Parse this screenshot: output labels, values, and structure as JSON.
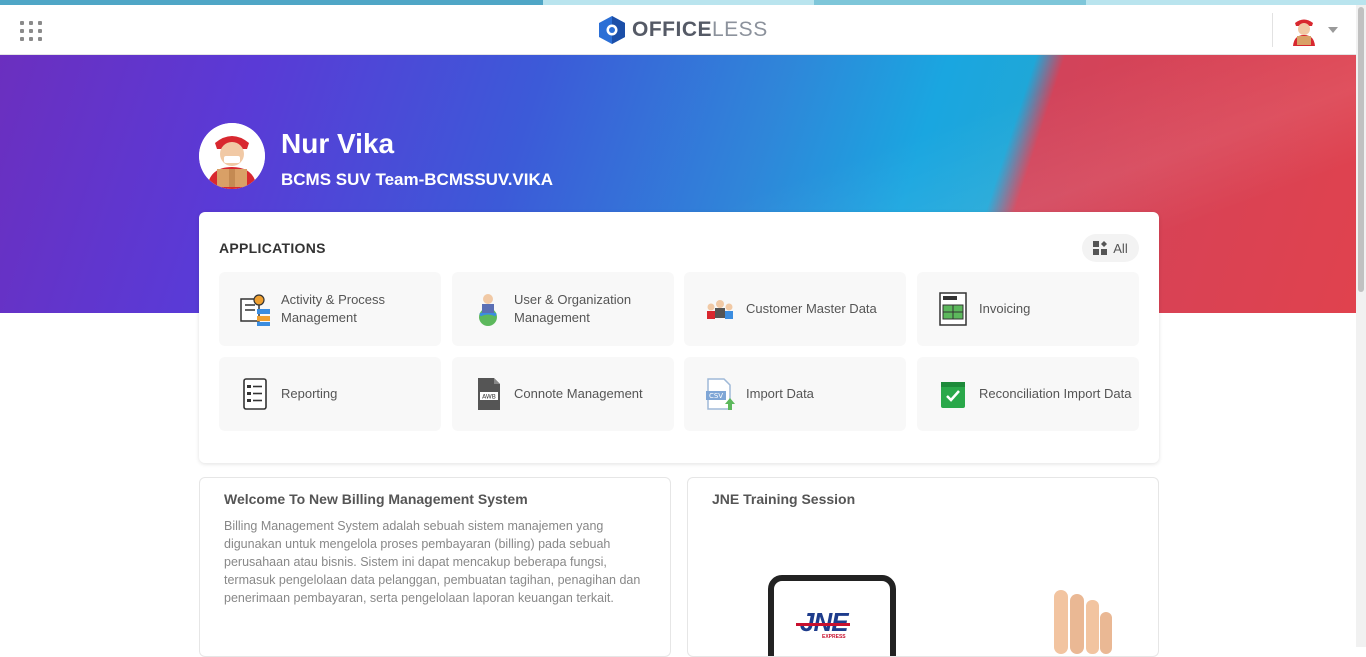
{
  "header": {
    "brand_bold": "OFFICE",
    "brand_light": "LESS",
    "apps_grid_icon": "grid-icon",
    "user_avatar_icon": "courier-avatar-icon",
    "menu_caret_icon": "chevron-down-icon"
  },
  "profile": {
    "name": "Nur Vika",
    "team": "BCMS SUV Team-BCMSSUV.VIKA"
  },
  "applications": {
    "title": "APPLICATIONS",
    "all_label": "All",
    "items": [
      {
        "label": "Activity & Process Management",
        "icon": "process-gear-icon"
      },
      {
        "label": "User & Organization Management",
        "icon": "user-globe-icon"
      },
      {
        "label": "Customer Master Data",
        "icon": "customers-group-icon"
      },
      {
        "label": "Invoicing",
        "icon": "invoice-icon"
      },
      {
        "label": "Reporting",
        "icon": "report-checklist-icon"
      },
      {
        "label": "Connote Management",
        "icon": "awb-document-icon"
      },
      {
        "label": "Import Data",
        "icon": "csv-upload-icon"
      },
      {
        "label": "Reconciliation Import Data",
        "icon": "green-check-folder-icon"
      }
    ]
  },
  "welcome": {
    "title": "Welcome To New Billing Management System",
    "body": "Billing Management System adalah sebuah sistem manajemen yang digunakan untuk mengelola proses pembayaran (billing) pada sebuah perusahaan atau bisnis. Sistem ini dapat mencakup beberapa fungsi, termasuk pengelolaan data pelanggan, pembuatan tagihan, penagihan dan penerimaan pembayaran, serta pengelolaan laporan keuangan terkait."
  },
  "training": {
    "title": "JNE Training Session",
    "video_logo": "JNE",
    "video_logo_sub": "EXPRESS"
  },
  "colors": {
    "hero_purple": "#6b2fbf",
    "hero_blue": "#1aa6e0",
    "hero_red": "#e0424e",
    "logo_blue": "#2b6fd6"
  }
}
